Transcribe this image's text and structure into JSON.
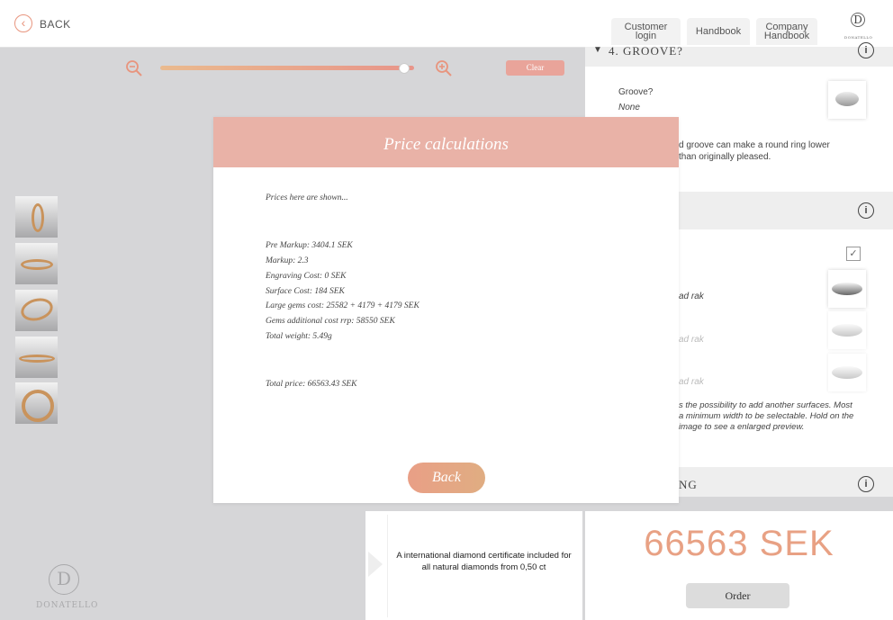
{
  "header": {
    "back_label": "BACK",
    "customer_login_line1": "Customer",
    "customer_login_line2": "login",
    "handbook": "Handbook",
    "company_handbook_line1": "Company",
    "company_handbook_line2": "Handbook",
    "logo_letter": "D",
    "logo_text": "DONATELLO"
  },
  "toolbar": {
    "clear_label": "Clear",
    "zoom_level": 0.96
  },
  "brand": {
    "logo_letter": "D",
    "logo_text": "DONATELLO"
  },
  "right_panel": {
    "groove_section_title": "4. GROOVE?",
    "groove_label": "Groove?",
    "groove_value": "None",
    "groove_desc_line1": "d groove can make a round ring lower",
    "groove_desc_line2": "than originally pleased.",
    "surface_option_1": "ad rak",
    "surface_option_2": "ad rak",
    "surface_option_3": "ad rak",
    "surface_desc_line1": "s the possibility to add another surfaces. Most",
    "surface_desc_line2": "a minimum width to be selectable. Hold on the",
    "surface_desc_line3": "image to see a enlarged preview.",
    "next_section_partial": "NG",
    "info_icon_glyph": "i"
  },
  "certificate": {
    "text": "A international diamond certificate included for all natural diamonds from 0,50 ct"
  },
  "summary": {
    "price": "66563 SEK",
    "order_label": "Order"
  },
  "modal": {
    "title": "Price calculations",
    "intro": "Prices here are shown...",
    "pre_markup": "Pre Markup: 3404.1 SEK",
    "markup": "Markup: 2.3",
    "engraving_cost": "Engraving Cost: 0 SEK",
    "surface_cost": "Surface Cost: 184 SEK",
    "large_gems_cost": "Large gems cost: 25582 + 4179 + 4179 SEK",
    "gems_additional": "Gems additional cost rrp: 58550 SEK",
    "total_weight": "Total weight: 5.49g",
    "total_price": "Total price: 66563.43 SEK",
    "back_label": "Back"
  },
  "colors": {
    "accent": "#e8957e",
    "modal_header": "#e9b2a7",
    "price": "#e8a184"
  }
}
